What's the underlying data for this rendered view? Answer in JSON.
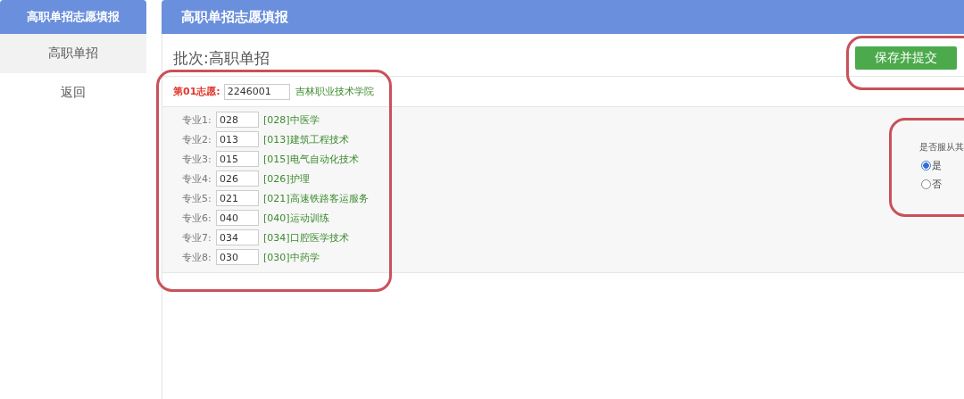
{
  "sidebar": {
    "title": "高职单招志愿填报",
    "items": [
      {
        "label": "高职单招",
        "selected": true
      },
      {
        "label": "返回",
        "selected": false
      }
    ]
  },
  "main": {
    "title": "高职单招志愿填报",
    "batch": "批次:高职单招",
    "submit_button": "保存并提交"
  },
  "choice": {
    "label": "第01志愿:",
    "code": "2246001",
    "school": "吉林职业技术学院"
  },
  "majors": [
    {
      "label": "专业1:",
      "code": "028",
      "name": "[028]中医学"
    },
    {
      "label": "专业2:",
      "code": "013",
      "name": "[013]建筑工程技术"
    },
    {
      "label": "专业3:",
      "code": "015",
      "name": "[015]电气自动化技术"
    },
    {
      "label": "专业4:",
      "code": "026",
      "name": "[026]护理"
    },
    {
      "label": "专业5:",
      "code": "021",
      "name": "[021]高速铁路客运服务"
    },
    {
      "label": "专业6:",
      "code": "040",
      "name": "[040]运动训练"
    },
    {
      "label": "专业7:",
      "code": "034",
      "name": "[034]口腔医学技术"
    },
    {
      "label": "专业8:",
      "code": "030",
      "name": "[030]中药学"
    }
  ],
  "obey": {
    "question": "是否服从其",
    "options": [
      {
        "label": "是",
        "selected": true
      },
      {
        "label": "否",
        "selected": false
      }
    ]
  }
}
